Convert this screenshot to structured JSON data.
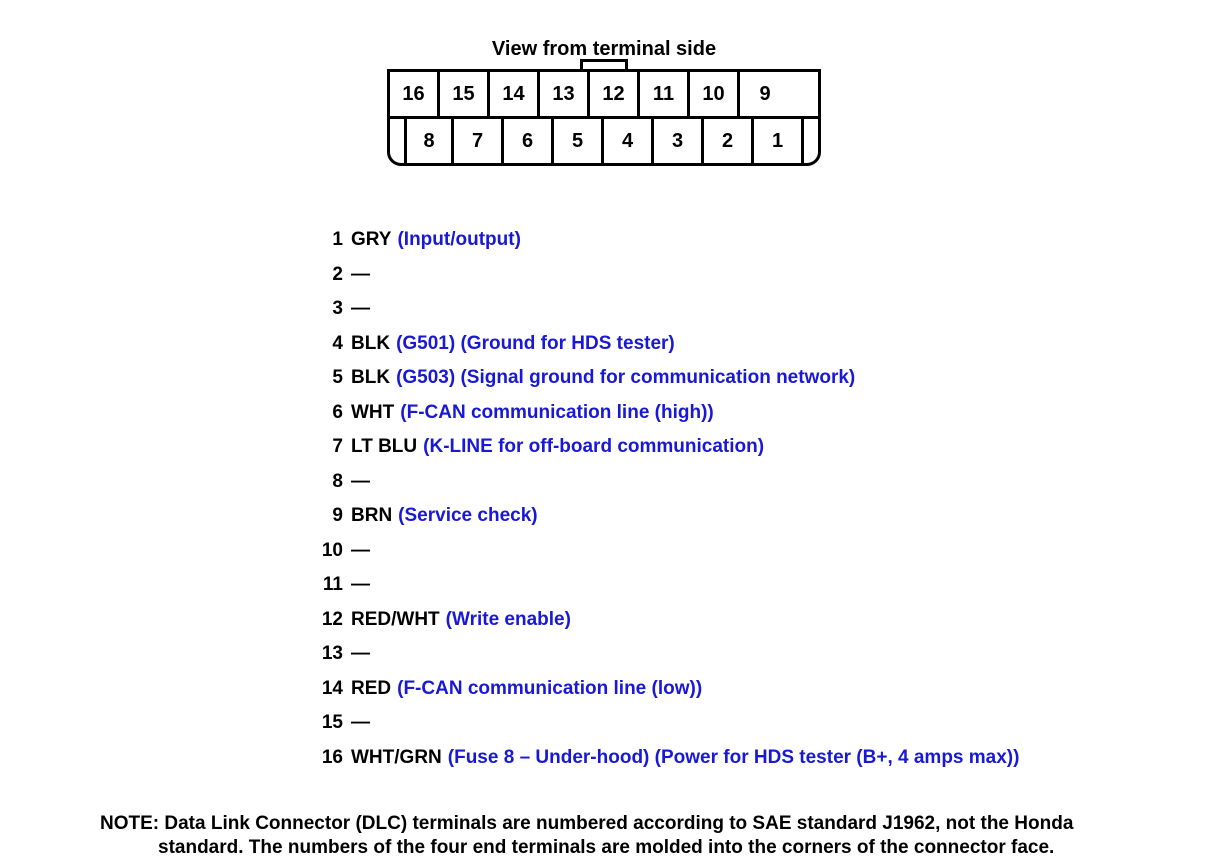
{
  "title": "View from terminal side",
  "connector": {
    "top_row": [
      "16",
      "15",
      "14",
      "13",
      "12",
      "11",
      "10",
      "9"
    ],
    "bottom_row": [
      "8",
      "7",
      "6",
      "5",
      "4",
      "3",
      "2",
      "1"
    ]
  },
  "pins": [
    {
      "num": "1",
      "color": "GRY",
      "desc": "(Input/output)"
    },
    {
      "num": "2",
      "color": "",
      "desc": ""
    },
    {
      "num": "3",
      "color": "",
      "desc": ""
    },
    {
      "num": "4",
      "color": "BLK",
      "desc": "(G501) (Ground for HDS tester)"
    },
    {
      "num": "5",
      "color": "BLK",
      "desc": "(G503) (Signal ground for communication network)"
    },
    {
      "num": "6",
      "color": "WHT",
      "desc": "(F-CAN communication line (high))"
    },
    {
      "num": "7",
      "color": "LT BLU",
      "desc": "(K-LINE for off-board communication)"
    },
    {
      "num": "8",
      "color": "",
      "desc": ""
    },
    {
      "num": "9",
      "color": "BRN",
      "desc": "(Service check)"
    },
    {
      "num": "10",
      "color": "",
      "desc": ""
    },
    {
      "num": "11",
      "color": "",
      "desc": ""
    },
    {
      "num": "12",
      "color": "RED/WHT",
      "desc": "(Write enable)"
    },
    {
      "num": "13",
      "color": "",
      "desc": ""
    },
    {
      "num": "14",
      "color": "RED",
      "desc": "(F-CAN communication line (low))"
    },
    {
      "num": "15",
      "color": "",
      "desc": ""
    },
    {
      "num": "16",
      "color": "WHT/GRN",
      "desc": "(Fuse 8 – Under-hood) (Power for HDS tester (B+, 4 amps max))"
    }
  ],
  "dash": "—",
  "note": {
    "label": "NOTE:",
    "line1": "Data Link Connector (DLC) terminals are numbered according to SAE standard J1962, not the Honda",
    "line2": "standard. The numbers of the four end terminals are molded into the corners of the connector face."
  }
}
